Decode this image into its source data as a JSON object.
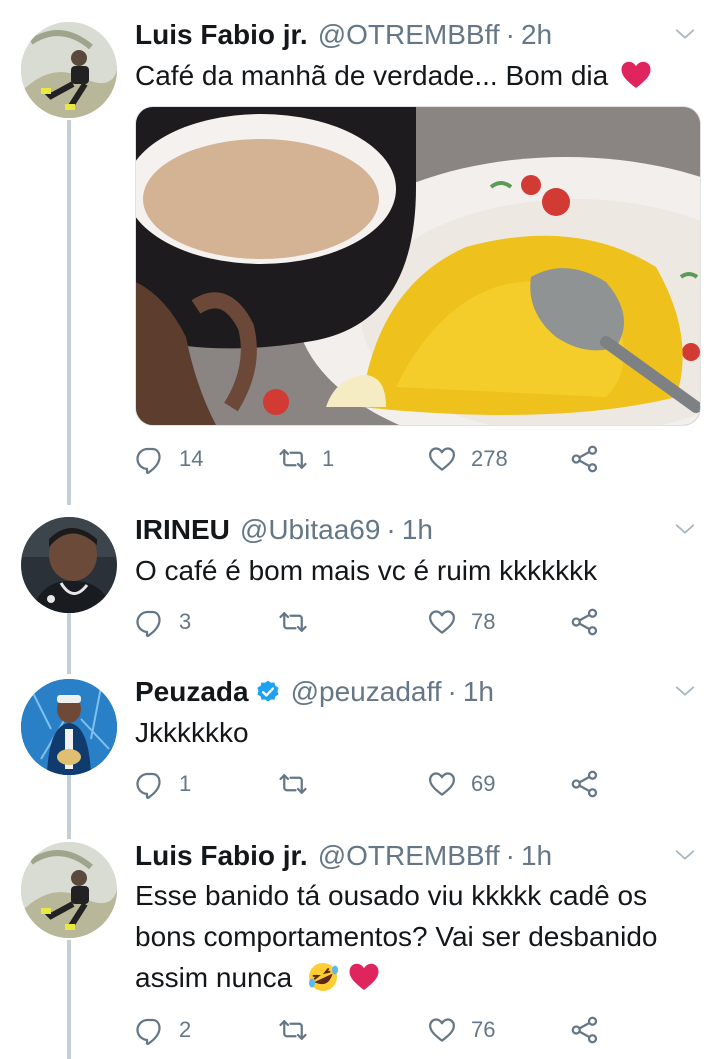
{
  "tweets": [
    {
      "name": "Luis Fabio jr.",
      "handle": "@OTREMBBff",
      "time": "2h",
      "text": "Café da manhã de verdade... Bom dia",
      "replies": "14",
      "retweets": "1",
      "likes": "278"
    },
    {
      "name": "IRINEU",
      "handle": "@Ubitaa69",
      "time": "1h",
      "text": "O café é bom mais vc é ruim kkkkkkk",
      "replies": "3",
      "retweets": "",
      "likes": "78"
    },
    {
      "name": "Peuzada",
      "handle": "@peuzadaff",
      "time": "1h",
      "text": "Jkkkkkko",
      "replies": "1",
      "retweets": "",
      "likes": "69"
    },
    {
      "name": "Luis Fabio jr.",
      "handle": "@OTREMBBff",
      "time": "1h",
      "text_line1": "Esse banido tá ousado viu kkkkk cadê os",
      "text_line2": "bons comportamentos? Vai ser desbanido",
      "text_line3": "assim nunca",
      "replies": "2",
      "retweets": "",
      "likes": "76"
    }
  ],
  "colors": {
    "text_secondary": "#657786",
    "thread_line": "#c4ced6",
    "verified_blue": "#1da1f2",
    "heart_red": "#e0245e"
  },
  "icons": [
    "reply-icon",
    "retweet-icon",
    "like-icon",
    "share-icon",
    "caret-down-icon",
    "verified-badge-icon",
    "red-heart-emoji",
    "rofl-emoji"
  ]
}
